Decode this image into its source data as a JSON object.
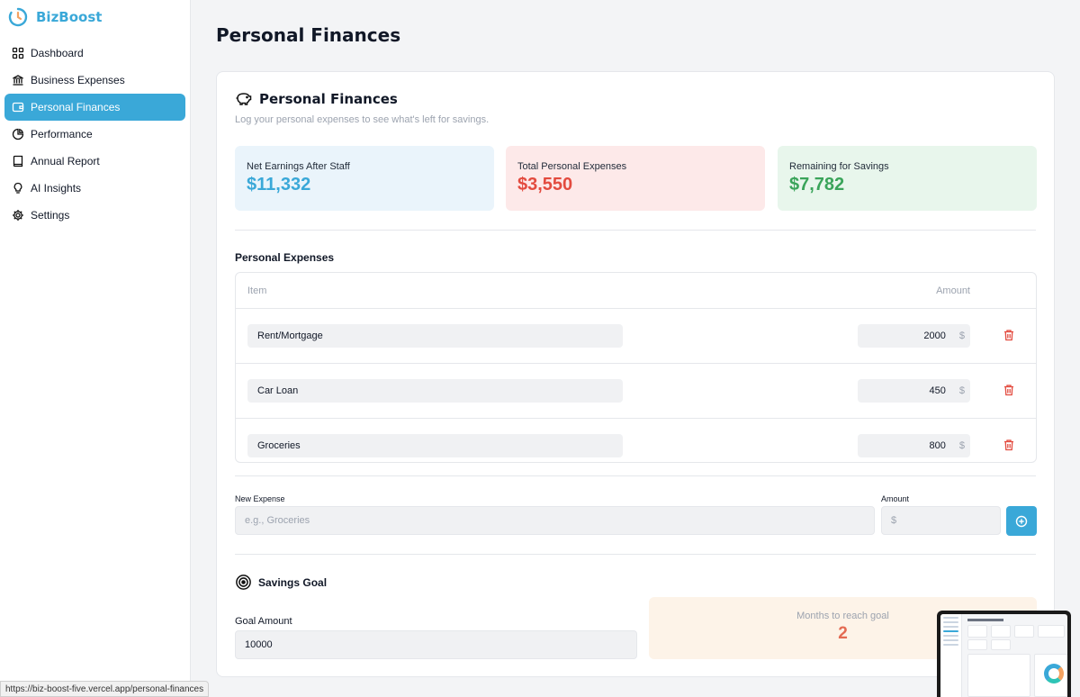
{
  "brand": {
    "name": "BizBoost"
  },
  "nav": {
    "items": [
      {
        "label": "Dashboard",
        "icon": "grid-icon",
        "active": false
      },
      {
        "label": "Business Expenses",
        "icon": "bank-icon",
        "active": false
      },
      {
        "label": "Personal Finances",
        "icon": "wallet-icon",
        "active": true
      },
      {
        "label": "Performance",
        "icon": "pie-chart-icon",
        "active": false
      },
      {
        "label": "Annual Report",
        "icon": "book-icon",
        "active": false
      },
      {
        "label": "AI Insights",
        "icon": "lightbulb-icon",
        "active": false
      },
      {
        "label": "Settings",
        "icon": "gear-icon",
        "active": false
      }
    ]
  },
  "page": {
    "title": "Personal Finances"
  },
  "card": {
    "title": "Personal Finances",
    "subtitle": "Log your personal expenses to see what's left for savings."
  },
  "stats": {
    "net": {
      "label": "Net Earnings After Staff",
      "value": "$11,332"
    },
    "expenses": {
      "label": "Total Personal Expenses",
      "value": "$3,550"
    },
    "savings": {
      "label": "Remaining for Savings",
      "value": "$7,782"
    }
  },
  "expenses": {
    "title": "Personal Expenses",
    "columns": {
      "item": "Item",
      "amount": "Amount"
    },
    "currency": "$",
    "rows": [
      {
        "item": "Rent/Mortgage",
        "amount": "2000"
      },
      {
        "item": "Car Loan",
        "amount": "450"
      },
      {
        "item": "Groceries",
        "amount": "800"
      }
    ]
  },
  "new_expense": {
    "label": "New Expense",
    "placeholder": "e.g., Groceries",
    "amount_label": "Amount",
    "amount_placeholder": "$"
  },
  "goal": {
    "title": "Savings Goal",
    "amount_label": "Goal Amount",
    "amount_value": "10000",
    "months_label": "Months to reach goal",
    "months_value": "2"
  },
  "status_bar": {
    "url": "https://biz-boost-five.vercel.app/personal-finances"
  },
  "colors": {
    "accent": "#3aa8d8",
    "danger": "#e34b3f",
    "success": "#3aa45a",
    "warning": "#e46b53"
  }
}
